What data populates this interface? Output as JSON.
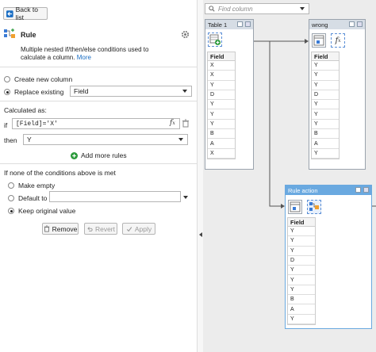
{
  "back_button": {
    "label": "Back to list"
  },
  "rule": {
    "title": "Rule",
    "description": "Multiple nested if/then/else conditions used to calculate a column.",
    "more_link": "More"
  },
  "output_mode": {
    "create_new": "Create new column",
    "replace_existing": "Replace existing",
    "field_selected": "Field",
    "selected": "replace_existing"
  },
  "calculated_as": {
    "label": "Calculated as:",
    "if_label": "if",
    "condition": "[Field]='X'",
    "then_label": "then",
    "then_value": "Y",
    "add_rules": "Add more rules"
  },
  "none_met": {
    "label": "If none of the conditions above is met",
    "make_empty": "Make empty",
    "default_to": "Default to",
    "default_value": "",
    "keep_original": "Keep original value",
    "selected": "keep_original"
  },
  "actions": {
    "remove": "Remove",
    "revert": "Revert",
    "apply": "Apply"
  },
  "canvas": {
    "search_placeholder": "Find column",
    "nodes": [
      {
        "title": "Table 1",
        "column": "Field",
        "values": [
          "X",
          "X",
          "Y",
          "D",
          "Y",
          "Y",
          "Y",
          "B",
          "A",
          "X"
        ]
      },
      {
        "title": "wrong",
        "column": "Field",
        "values": [
          "Y",
          "Y",
          "Y",
          "D",
          "Y",
          "Y",
          "Y",
          "B",
          "A",
          "Y"
        ]
      },
      {
        "title": "Rule action",
        "column": "Field",
        "values": [
          "Y",
          "Y",
          "Y",
          "D",
          "Y",
          "Y",
          "Y",
          "B",
          "A",
          "Y"
        ]
      }
    ]
  },
  "colors": {
    "accent": "#1a6ec4",
    "green": "#2a9a3a",
    "node_title_active": "#6aa9e0"
  }
}
